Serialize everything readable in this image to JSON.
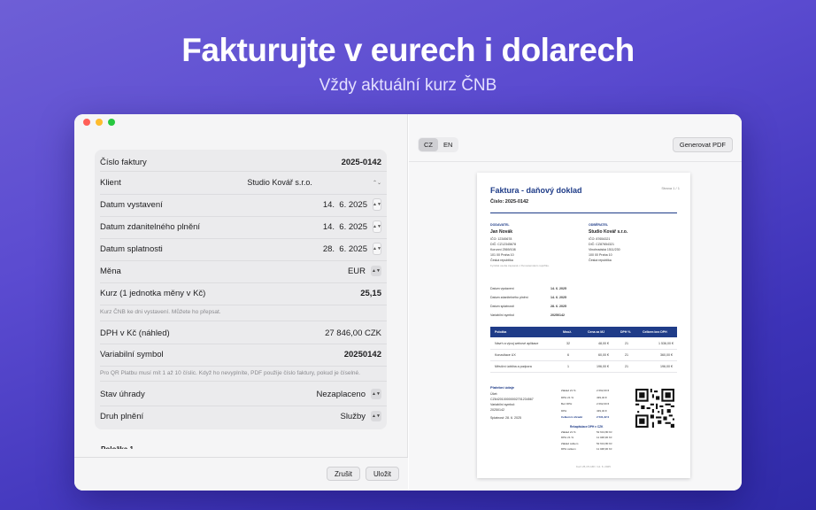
{
  "hero": {
    "title": "Fakturujte v eurech i dolarech",
    "subtitle": "Vždy aktuální kurz ČNB"
  },
  "form": {
    "invoice_number": {
      "label": "Číslo faktury",
      "value": "2025-0142"
    },
    "client": {
      "label": "Klient",
      "value": "Studio Kovář s.r.o."
    },
    "issue_date": {
      "label": "Datum vystavení",
      "value": "14.  6. 2025"
    },
    "taxable_date": {
      "label": "Datum zdanitelného plnění",
      "value": "14.  6. 2025"
    },
    "due_date": {
      "label": "Datum splatnosti",
      "value": "28.  6. 2025"
    },
    "currency": {
      "label": "Měna",
      "value": "EUR"
    },
    "rate": {
      "label": "Kurz (1 jednotka měny v Kč)",
      "value": "25,15"
    },
    "rate_note": "Kurz ČNB ke dni vystavení. Můžete ho přepsat.",
    "vat_preview": {
      "label": "DPH v Kč (náhled)",
      "value": "27 846,00 CZK"
    },
    "variable_symbol": {
      "label": "Variabilní symbol",
      "value": "20250142"
    },
    "vs_note": "Pro QR Platbu musí mít 1 až 10 číslic. Když ho nevyplníte, PDF použije číslo faktury, pokud je číselné.",
    "payment_status": {
      "label": "Stav úhrady",
      "value": "Nezaplaceno"
    },
    "supply_type": {
      "label": "Druh plnění",
      "value": "Služby"
    },
    "items_header": "Položka 1"
  },
  "footer": {
    "cancel": "Zrušit",
    "save": "Uložit"
  },
  "preview": {
    "lang_cz": "CZ",
    "lang_en": "EN",
    "generate": "Generovat PDF",
    "doc": {
      "title": "Faktura - daňový doklad",
      "number": "Číslo: 2025-0142",
      "page": "Strana 1 / 1",
      "supplier_h": "DODAVATEL",
      "supplier_name": "Jan Novák",
      "supplier_lines": [
        "IČO: 12345678",
        "DIČ: CZ12345678",
        "Korunní 2569/108",
        "101 00 Praha 10",
        "Česká republika",
        "Fyzická osoba zapsaná v živnostenském rejstříku."
      ],
      "customer_h": "ODBĚRATEL",
      "customer_name": "Studio Kovář s.r.o.",
      "customer_lines": [
        "IČO: 87654321",
        "DIČ: CZ87654321",
        "Vinohradská 1511/230",
        "100 00 Praha 10",
        "Česká republika"
      ],
      "dates": [
        [
          "Datum vystavení",
          "14. 6. 2025"
        ],
        [
          "Datum zdanitelného plnění",
          "14. 6. 2025"
        ],
        [
          "Datum splatnosti",
          "28. 6. 2025"
        ],
        [
          "Variabilní symbol",
          "20250142"
        ]
      ],
      "table_headers": [
        "Položka",
        "Množ.",
        "Cena za MJ",
        "DPH %",
        "Celkem bez DPH"
      ],
      "rows": [
        [
          "Návrh a vývoj webové aplikace",
          "32",
          "48,00 €",
          "21",
          "1 536,00 €"
        ],
        [
          "Konzultace UX",
          "6",
          "60,00 €",
          "21",
          "360,00 €"
        ],
        [
          "Měsíční údržba a podpora",
          "1",
          "196,00 €",
          "21",
          "196,00 €"
        ]
      ],
      "pay_h": "Platební údaje",
      "pay_lines": [
        "Účet:",
        "CZ6420100000002701234567",
        "Variabilní symbol:",
        "20250142",
        "Splatnost: 28. 6. 2025"
      ],
      "totals": [
        [
          "Základ 21 %",
          "2 092,00 €"
        ],
        [
          "DPH 21 %",
          "439,32 €"
        ],
        [
          "Bez DPH",
          "2 092,00 €"
        ],
        [
          "DPH",
          "439,32 €"
        ],
        [
          "Celkem k úhradě",
          "2 531,32 €"
        ]
      ],
      "recap_h": "Rekapitulace DPH v CZK",
      "recap": [
        [
          "Základ 21 %",
          "52 613,80 Kč"
        ],
        [
          "DPH 21 %",
          "11 048,90 Kč"
        ],
        [
          "Základ celkem",
          "52 613,80 Kč"
        ],
        [
          "DPH celkem",
          "11 048,90 Kč"
        ]
      ],
      "footer_note": "Kurz 25,15 CZK / 14. 6. 2025"
    }
  }
}
